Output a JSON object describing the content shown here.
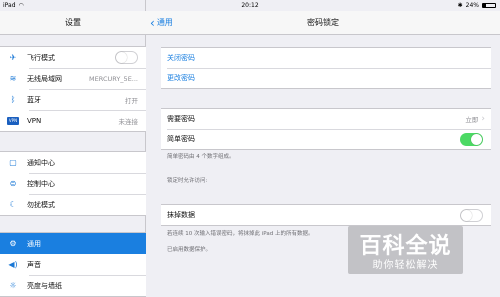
{
  "status_bar": {
    "carrier": "iPad",
    "wifi_icon": "wifi-icon",
    "time": "20:12",
    "battery_text": "24%",
    "battery_level": 0.24,
    "bluetooth_icon": "bluetooth-icon"
  },
  "sidebar": {
    "title": "设置",
    "items": [
      {
        "label": "飞行模式",
        "icon": "airplane-icon",
        "toggle": "off"
      },
      {
        "label": "无线局域网",
        "icon": "wifi-icon",
        "value": "MERCURY_5E..."
      },
      {
        "label": "蓝牙",
        "icon": "bluetooth-icon",
        "value": "打开"
      },
      {
        "label": "VPN",
        "icon": "vpn-icon",
        "icon_text": "VPN",
        "value": "未连接"
      },
      {
        "label": "通知中心",
        "icon": "notification-center-icon"
      },
      {
        "label": "控制中心",
        "icon": "control-center-icon"
      },
      {
        "label": "勿扰模式",
        "icon": "do-not-disturb-icon"
      },
      {
        "label": "通用",
        "icon": "gear-icon",
        "selected": true
      },
      {
        "label": "声音",
        "icon": "speaker-icon"
      },
      {
        "label": "亮度与墙纸",
        "icon": "brightness-icon"
      }
    ]
  },
  "nav": {
    "back_label": "通用",
    "title": "密码锁定"
  },
  "passcode": {
    "turn_off": "关闭密码",
    "change": "更改密码",
    "require_label": "需要密码",
    "require_value": "立即",
    "simple_label": "简单密码",
    "simple_on": true,
    "simple_note": "简单密码由 4 个数字组成。",
    "allow_header": "锁定时允许访问:",
    "erase_label": "抹掉数据",
    "erase_on": false,
    "erase_note": "若连续 10 次输入错误密码，将抹掉此 iPad 上的所有数据。",
    "erase_enabled_note": "已启用数据保护。"
  },
  "watermark": {
    "title": "百科全说",
    "subtitle": "助你轻松解决"
  },
  "colors": {
    "accent": "#1a7fe0",
    "toggle_on": "#4cd964",
    "background": "#efeff4"
  }
}
